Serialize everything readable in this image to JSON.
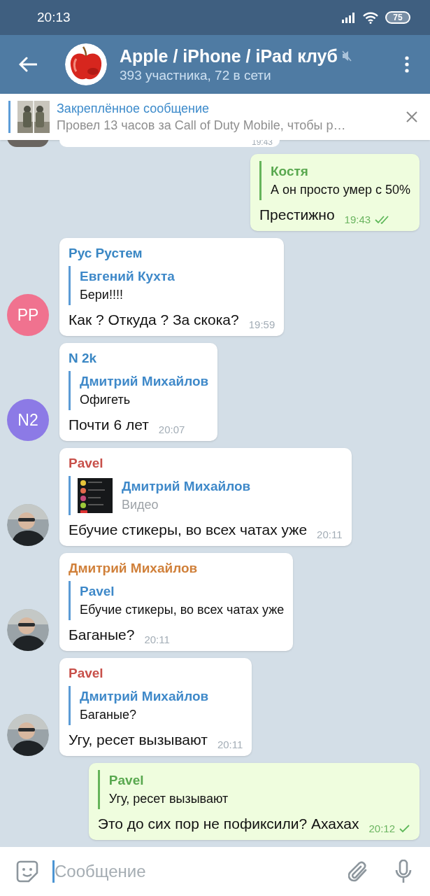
{
  "status_bar": {
    "time": "20:13",
    "battery": "75"
  },
  "header": {
    "title": "Apple / iPhone / iPad клуб",
    "muted": true,
    "subtitle": "393 участника, 72 в сети"
  },
  "pinned": {
    "title": "Закреплённое сообщение",
    "text": "Провел 13 часов за Call of Duty Mobile, чтобы р…"
  },
  "messages": [
    {
      "kind": "partial",
      "time": "19:43"
    },
    {
      "kind": "out",
      "reply": {
        "name": "Костя",
        "text": "А он просто умер с 50%"
      },
      "text": "Престижно",
      "time": "19:43",
      "read": true
    },
    {
      "kind": "in",
      "sender": {
        "name": "Рус Рустем",
        "color": "#3a87c4"
      },
      "avatar": {
        "kind": "initials",
        "initials": "PP",
        "color": "#f0728f"
      },
      "reply": {
        "name": "Евгений Кухта",
        "text": "Бери!!!!"
      },
      "text": "Как ? Откуда ? За скока?",
      "time": "19:59"
    },
    {
      "kind": "in",
      "sender": {
        "name": "N 2k",
        "color": "#3a87c4"
      },
      "avatar": {
        "kind": "initials",
        "initials": "N2",
        "color": "#8c7ae6"
      },
      "reply": {
        "name": "Дмитрий Михайлов",
        "text": "Офигеть"
      },
      "text": "Почти 6 лет",
      "time": "20:07"
    },
    {
      "kind": "in",
      "sender": {
        "name": "Pavel",
        "color": "#c8504a"
      },
      "reply": {
        "name": "Дмитрий Михайлов",
        "text": "Видео",
        "media": true
      },
      "text": "Ебучие стикеры, во всех чатах уже",
      "time": "20:11"
    },
    {
      "kind": "in",
      "sender": {
        "name": "Дмитрий Михайлов",
        "color": "#d0803a"
      },
      "reply": {
        "name": "Pavel",
        "text": "Ебучие стикеры, во всех чатах уже"
      },
      "text": "Баганые?",
      "time": "20:11"
    },
    {
      "kind": "in",
      "sender": {
        "name": "Pavel",
        "color": "#c8504a"
      },
      "reply": {
        "name": "Дмитрий Михайлов",
        "text": "Баганые?"
      },
      "text": "Угу, ресет вызывают",
      "time": "20:11"
    },
    {
      "kind": "out",
      "reply": {
        "name": "Pavel",
        "text": "Угу, ресет вызывают"
      },
      "text": "Это до сих пор не пофиксили? Ахахах",
      "time": "20:12",
      "read": false
    }
  ],
  "composer": {
    "placeholder": "Сообщение"
  }
}
